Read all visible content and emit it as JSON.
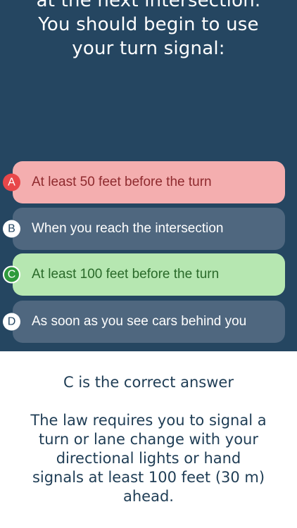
{
  "question": {
    "lines": [
      "at the next intersection.",
      "You should begin to use",
      "your turn signal:"
    ]
  },
  "options": [
    {
      "letter": "A",
      "text": "At least 50 feet before the turn",
      "state": "incorrect-selected"
    },
    {
      "letter": "B",
      "text": "When you reach the intersection",
      "state": "neutral"
    },
    {
      "letter": "C",
      "text": "At least 100 feet before the turn",
      "state": "correct"
    },
    {
      "letter": "D",
      "text": "As soon as you see cars behind you",
      "state": "neutral"
    }
  ],
  "result": {
    "headline": "C is the correct answer",
    "explanation_lines": [
      "The law requires you to signal a",
      "turn or lane change with your",
      "directional lights or hand",
      "signals at least 100 feet (30 m)",
      "ahead."
    ]
  },
  "colors": {
    "panel_bg": "#254661",
    "option_neutral": "#4f677f",
    "option_incorrect": "#f4aeaf",
    "option_correct": "#b6e7b1",
    "badge_incorrect": "#e8474a",
    "badge_correct": "#2f9a3c"
  }
}
